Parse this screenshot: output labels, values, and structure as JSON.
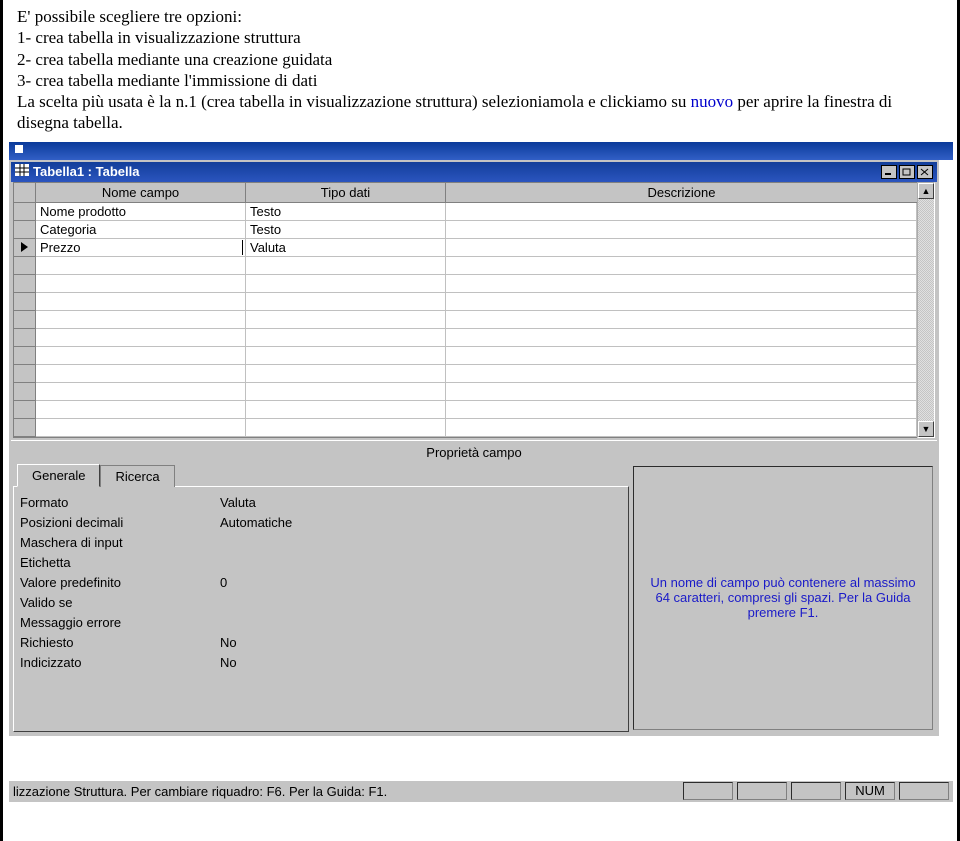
{
  "doc": {
    "line1": "E' possibile scegliere tre opzioni:",
    "line2": "1- crea tabella in visualizzazione struttura",
    "line3": "2- crea tabella mediante una creazione guidata",
    "line4": "3- crea tabella mediante l'immissione di dati",
    "line5": "La scelta più usata è la n.1 (crea tabella in visualizzazione struttura) selezioniamola e clickiamo su ",
    "link": "nuovo",
    "line5b": " per aprire la finestra di disegna tabella."
  },
  "outerTitle": "",
  "window": {
    "title": "Tabella1 : Tabella"
  },
  "grid": {
    "headers": {
      "selector": "",
      "name": "Nome campo",
      "type": "Tipo dati",
      "desc": "Descrizione"
    },
    "rows": [
      {
        "marker": "",
        "name": "Nome prodotto",
        "type": "Testo",
        "desc": ""
      },
      {
        "marker": "",
        "name": "Categoria",
        "type": "Testo",
        "desc": ""
      },
      {
        "marker": "▶",
        "name": "Prezzo",
        "type": "Valuta",
        "desc": ""
      }
    ]
  },
  "midLabel": "Proprietà campo",
  "tabs": {
    "general": "Generale",
    "lookup": "Ricerca"
  },
  "properties": [
    {
      "label": "Formato",
      "value": "Valuta"
    },
    {
      "label": "Posizioni decimali",
      "value": "Automatiche"
    },
    {
      "label": "Maschera di input",
      "value": ""
    },
    {
      "label": "Etichetta",
      "value": ""
    },
    {
      "label": "Valore predefinito",
      "value": "0"
    },
    {
      "label": "Valido se",
      "value": ""
    },
    {
      "label": "Messaggio errore",
      "value": ""
    },
    {
      "label": "Richiesto",
      "value": "No"
    },
    {
      "label": "Indicizzato",
      "value": "No"
    }
  ],
  "helpText": "Un nome di campo può contenere al massimo 64 caratteri, compresi gli spazi. Per la Guida premere F1.",
  "status": {
    "main": "lizzazione Struttura. Per cambiare riquadro: F6. Per la Guida: F1.",
    "num": "NUM"
  }
}
